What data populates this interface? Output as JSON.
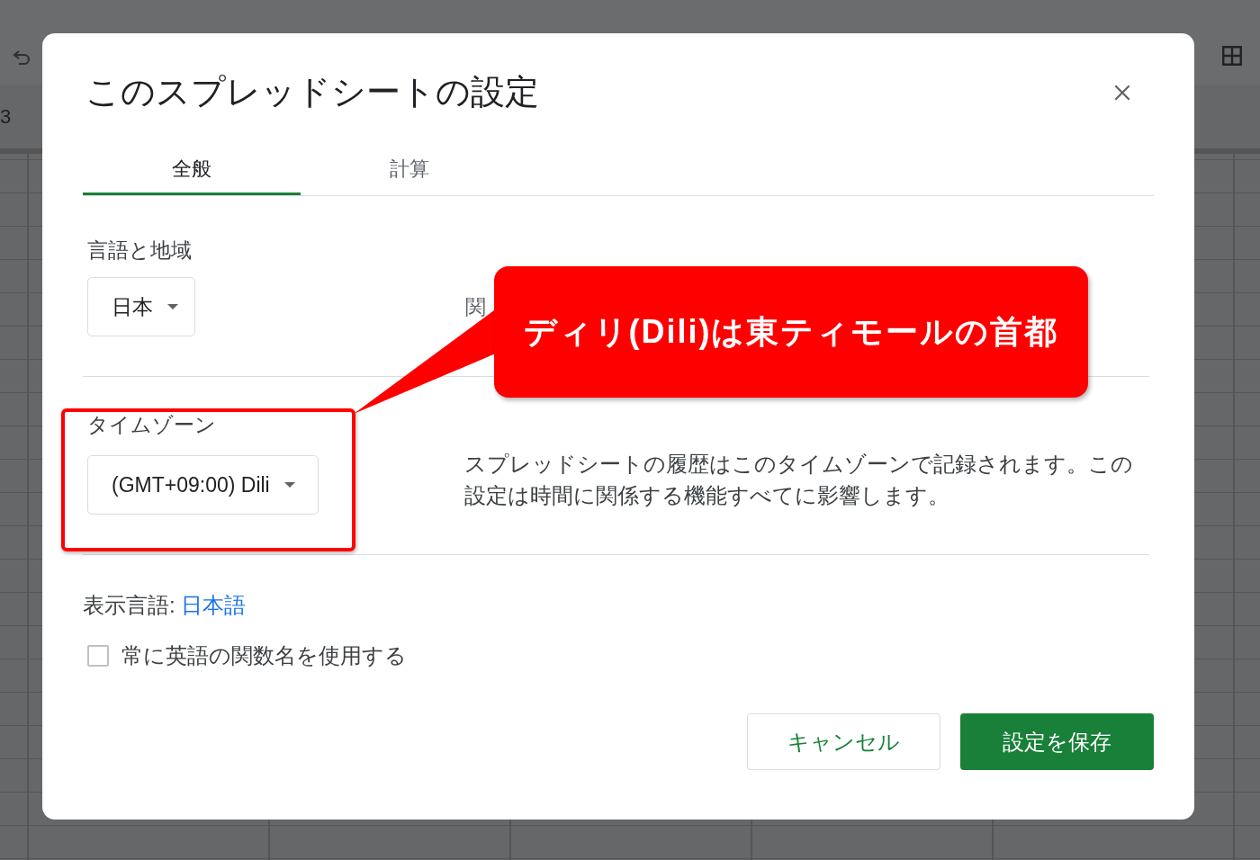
{
  "background": {
    "row_number": "3"
  },
  "dialog": {
    "title": "このスプレッドシートの設定",
    "tabs": [
      {
        "label": "全般",
        "selected": true
      },
      {
        "label": "計算",
        "selected": false
      }
    ],
    "locale": {
      "label": "言語と地域",
      "value": "日本",
      "side_text": "関"
    },
    "timezone": {
      "label": "タイムゾーン",
      "value": "(GMT+09:00) Dili",
      "description": "スプレッドシートの履歴はこのタイムゾーンで記録されます。この設定は時間に関係する機能すべてに影響します。"
    },
    "display_language": {
      "label": "表示言語:",
      "link": "日本語"
    },
    "english_functions": {
      "label": "常に英語の関数名を使用する",
      "checked": false
    },
    "buttons": [
      {
        "label": "キャンセル",
        "kind": "secondary"
      },
      {
        "label": "設定を保存",
        "kind": "primary"
      }
    ]
  },
  "callout": {
    "text": "ディリ(Dili)は東ティモールの首都"
  }
}
